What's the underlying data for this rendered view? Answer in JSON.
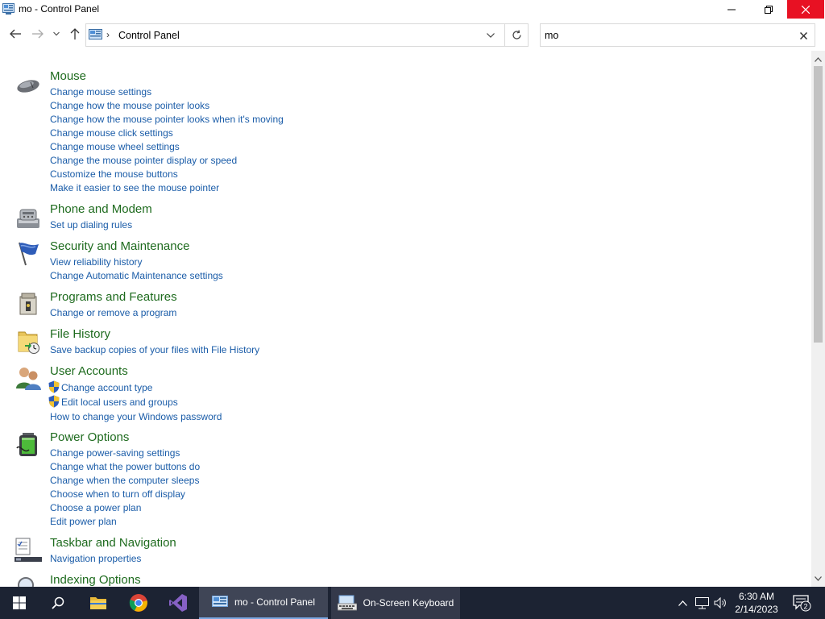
{
  "window": {
    "title": "mo - Control Panel"
  },
  "address": {
    "separator": "›",
    "breadcrumb": "Control Panel"
  },
  "search": {
    "value": "mo",
    "placeholder": ""
  },
  "groups": [
    {
      "title": "Mouse",
      "icon": "mouse-icon",
      "links": [
        "Change mouse settings",
        "Change how the mouse pointer looks",
        "Change how the mouse pointer looks when it's moving",
        "Change mouse click settings",
        "Change mouse wheel settings",
        "Change the mouse pointer display or speed",
        "Customize the mouse buttons",
        "Make it easier to see the mouse pointer"
      ]
    },
    {
      "title": "Phone and Modem",
      "icon": "phone-modem-icon",
      "links": [
        "Set up dialing rules"
      ]
    },
    {
      "title": "Security and Maintenance",
      "icon": "flag-icon",
      "links": [
        "View reliability history",
        "Change Automatic Maintenance settings"
      ]
    },
    {
      "title": "Programs and Features",
      "icon": "programs-icon",
      "links": [
        "Change or remove a program"
      ]
    },
    {
      "title": "File History",
      "icon": "file-history-icon",
      "links": [
        "Save backup copies of your files with File History"
      ]
    },
    {
      "title": "User Accounts",
      "icon": "users-icon",
      "links": [
        "Change account type",
        "Edit local users and groups",
        "How to change your Windows password"
      ],
      "shield_links": [
        true,
        true,
        false
      ]
    },
    {
      "title": "Power Options",
      "icon": "battery-icon",
      "links": [
        "Change power-saving settings",
        "Change what the power buttons do",
        "Change when the computer sleeps",
        "Choose when to turn off display",
        "Choose a power plan",
        "Edit power plan"
      ]
    },
    {
      "title": "Taskbar and Navigation",
      "icon": "taskbar-icon",
      "links": [
        "Navigation properties"
      ]
    },
    {
      "title": "Indexing Options",
      "icon": "magnifier-icon",
      "links": []
    }
  ],
  "taskbar": {
    "apps": [
      {
        "label": "mo - Control Panel",
        "icon": "control-panel-icon",
        "active": true
      },
      {
        "label": "On-Screen Keyboard",
        "icon": "keyboard-icon",
        "active": false
      }
    ],
    "clock": {
      "time": "6:30 AM",
      "date": "2/14/2023"
    },
    "notification_count": "2"
  },
  "colors": {
    "link": "#1a5ca8",
    "group_title": "#1e6b1e",
    "close_button": "#e81123",
    "taskbar": "#1c2333"
  }
}
